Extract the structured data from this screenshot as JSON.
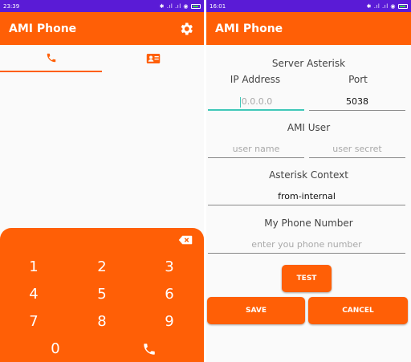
{
  "left": {
    "status": {
      "time": "23:39",
      "icons": "✱ .ıl .ıl ◉"
    },
    "appbar": {
      "title": "AMI Phone"
    },
    "keypad": {
      "keys": [
        "1",
        "2",
        "3",
        "4",
        "5",
        "6",
        "7",
        "8",
        "9",
        "0"
      ]
    }
  },
  "right": {
    "status": {
      "time": "16:01",
      "icons": "✱ .ıl .ıl ◉"
    },
    "appbar": {
      "title": "AMI Phone"
    },
    "form": {
      "server_heading": "Server Asterisk",
      "ip_label": "IP Address",
      "port_label": "Port",
      "ip_placeholder": "0.0.0.0",
      "port_value": "5038",
      "ami_user_heading": "AMI User",
      "user_name_placeholder": "user name",
      "user_secret_placeholder": "user secret",
      "context_heading": "Asterisk Context",
      "context_value": "from-internal",
      "phone_heading": "My Phone Number",
      "phone_placeholder": "enter you phone number"
    },
    "buttons": {
      "test": "TEST",
      "save": "SAVE",
      "cancel": "CANCEL"
    }
  },
  "colors": {
    "accent": "#ff5f06",
    "statusbar": "#5a1bd6",
    "focus": "#3fc8b8"
  }
}
